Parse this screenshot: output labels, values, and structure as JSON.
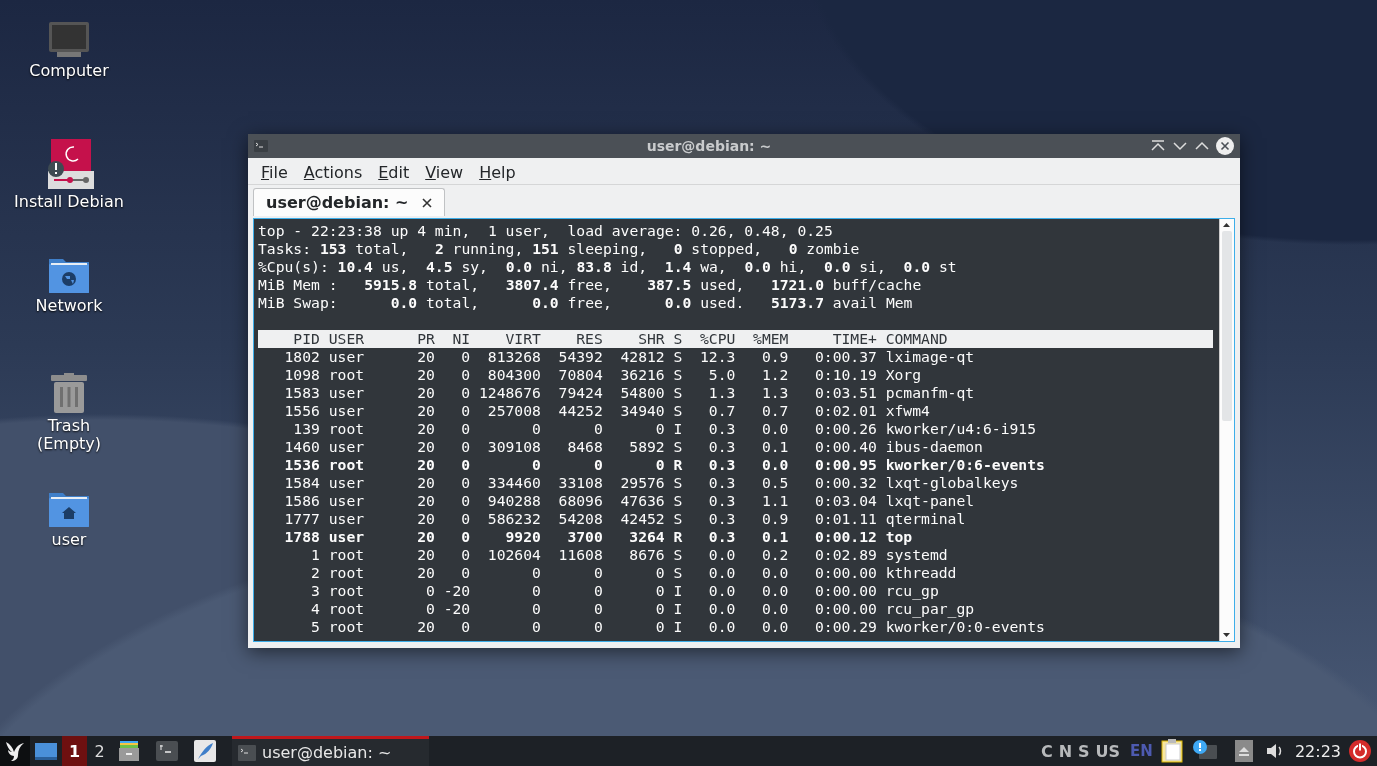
{
  "desktop_icons": [
    {
      "label": "Computer",
      "kind": "computer"
    },
    {
      "label": "Install Debian",
      "kind": "installer"
    },
    {
      "label": "Network",
      "kind": "network"
    },
    {
      "label": "Trash\n(Empty)",
      "kind": "trash"
    },
    {
      "label": "user",
      "kind": "home"
    }
  ],
  "window": {
    "title": "user@debian: ~",
    "menu": [
      "File",
      "Actions",
      "Edit",
      "View",
      "Help"
    ],
    "tabs": [
      {
        "label": "user@debian: ~",
        "selected": true
      }
    ],
    "terminal": {
      "summary": [
        "top - 22:23:38 up 4 min,  1 user,  load average: 0.26, 0.48, 0.25",
        "Tasks: **153** total,   **2** running, **151** sleeping,   **0** stopped,   **0** zombie",
        "%Cpu(s): **10.4** us,  **4.5** sy,  **0.0** ni, **83.8** id,  **1.4** wa,  **0.0** hi,  **0.0** si,  **0.0** st",
        "MiB Mem :   **5915.8** total,   **3807.4** free,    **387.5** used,   **1721.0** buff/cache",
        "MiB Swap:      **0.0** total,      **0.0** free,      **0.0** used.   **5173.7** avail Mem"
      ],
      "columns": [
        "PID",
        "USER",
        "PR",
        "NI",
        "VIRT",
        "RES",
        "SHR",
        "S",
        "%CPU",
        "%MEM",
        "TIME+",
        "COMMAND"
      ],
      "processes": [
        {
          "cells": [
            "1802",
            "user",
            "20",
            "0",
            "813268",
            "54392",
            "42812",
            "S",
            "12.3",
            "0.9",
            "0:00.37",
            "lximage-qt"
          ],
          "highlighted": false
        },
        {
          "cells": [
            "1098",
            "root",
            "20",
            "0",
            "804300",
            "70804",
            "36216",
            "S",
            "5.0",
            "1.2",
            "0:10.19",
            "Xorg"
          ],
          "highlighted": false
        },
        {
          "cells": [
            "1583",
            "user",
            "20",
            "0",
            "1248676",
            "79424",
            "54800",
            "S",
            "1.3",
            "1.3",
            "0:03.51",
            "pcmanfm-qt"
          ],
          "highlighted": false
        },
        {
          "cells": [
            "1556",
            "user",
            "20",
            "0",
            "257008",
            "44252",
            "34940",
            "S",
            "0.7",
            "0.7",
            "0:02.01",
            "xfwm4"
          ],
          "highlighted": false
        },
        {
          "cells": [
            "139",
            "root",
            "20",
            "0",
            "0",
            "0",
            "0",
            "I",
            "0.3",
            "0.0",
            "0:00.26",
            "kworker/u4:6-i915"
          ],
          "highlighted": false
        },
        {
          "cells": [
            "1460",
            "user",
            "20",
            "0",
            "309108",
            "8468",
            "5892",
            "S",
            "0.3",
            "0.1",
            "0:00.40",
            "ibus-daemon"
          ],
          "highlighted": false
        },
        {
          "cells": [
            "1536",
            "root",
            "20",
            "0",
            "0",
            "0",
            "0",
            "R",
            "0.3",
            "0.0",
            "0:00.95",
            "kworker/0:6-events"
          ],
          "highlighted": true
        },
        {
          "cells": [
            "1584",
            "user",
            "20",
            "0",
            "334460",
            "33108",
            "29576",
            "S",
            "0.3",
            "0.5",
            "0:00.32",
            "lxqt-globalkeys"
          ],
          "highlighted": false
        },
        {
          "cells": [
            "1586",
            "user",
            "20",
            "0",
            "940288",
            "68096",
            "47636",
            "S",
            "0.3",
            "1.1",
            "0:03.04",
            "lxqt-panel"
          ],
          "highlighted": false
        },
        {
          "cells": [
            "1777",
            "user",
            "20",
            "0",
            "586232",
            "54208",
            "42452",
            "S",
            "0.3",
            "0.9",
            "0:01.11",
            "qterminal"
          ],
          "highlighted": false
        },
        {
          "cells": [
            "1788",
            "user",
            "20",
            "0",
            "9920",
            "3700",
            "3264",
            "R",
            "0.3",
            "0.1",
            "0:00.12",
            "top"
          ],
          "highlighted": true
        },
        {
          "cells": [
            "1",
            "root",
            "20",
            "0",
            "102604",
            "11608",
            "8676",
            "S",
            "0.0",
            "0.2",
            "0:02.89",
            "systemd"
          ],
          "highlighted": false
        },
        {
          "cells": [
            "2",
            "root",
            "20",
            "0",
            "0",
            "0",
            "0",
            "S",
            "0.0",
            "0.0",
            "0:00.00",
            "kthreadd"
          ],
          "highlighted": false
        },
        {
          "cells": [
            "3",
            "root",
            "0",
            "-20",
            "0",
            "0",
            "0",
            "I",
            "0.0",
            "0.0",
            "0:00.00",
            "rcu_gp"
          ],
          "highlighted": false
        },
        {
          "cells": [
            "4",
            "root",
            "0",
            "-20",
            "0",
            "0",
            "0",
            "I",
            "0.0",
            "0.0",
            "0:00.00",
            "rcu_par_gp"
          ],
          "highlighted": false
        },
        {
          "cells": [
            "5",
            "root",
            "20",
            "0",
            "0",
            "0",
            "0",
            "I",
            "0.0",
            "0.0",
            "0:00.29",
            "kworker/0:0-events"
          ],
          "highlighted": false
        }
      ]
    }
  },
  "taskbar": {
    "workspaces": [
      {
        "label": "1",
        "selected": true
      },
      {
        "label": "2",
        "selected": false
      }
    ],
    "tasks": [
      {
        "label": "user@debian: ~",
        "selected": true
      }
    ],
    "indicators": [
      "C",
      "N",
      "S",
      "US"
    ],
    "layout": "EN",
    "clock": "22:23"
  }
}
